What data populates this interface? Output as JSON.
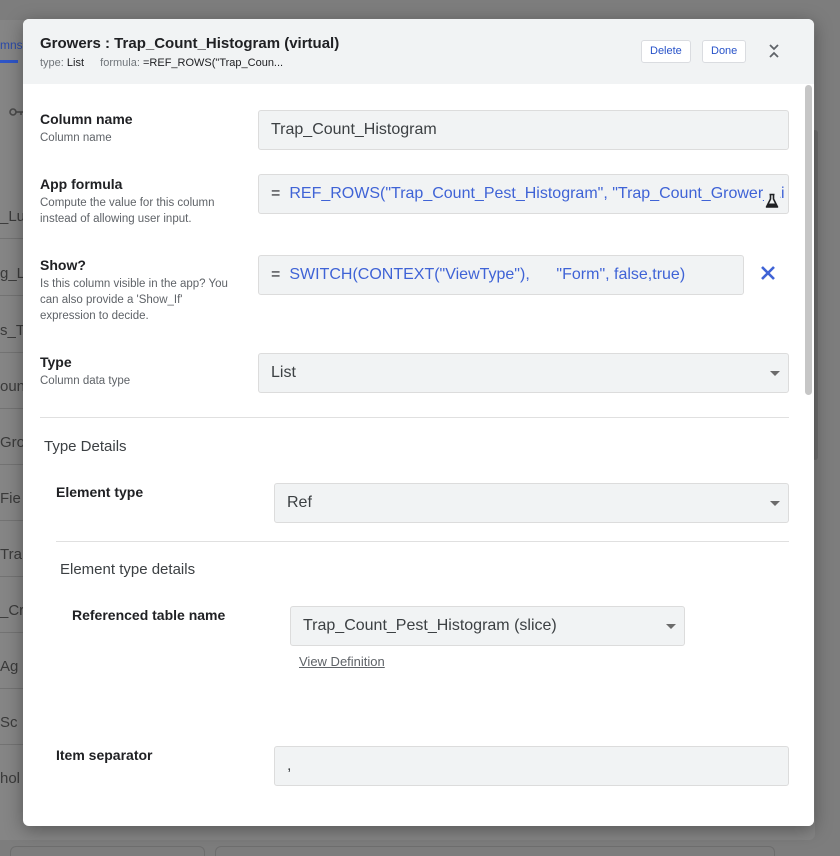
{
  "background": {
    "tab_label": "mns",
    "rows": [
      "_Lu",
      "g_L",
      "s_T",
      "oun",
      "Gro",
      "Fie",
      "Tra",
      "_Cr",
      "Ag",
      "Sc",
      "hol"
    ]
  },
  "header": {
    "title": "Growers : Trap_Count_Histogram (virtual)",
    "type_label": "type:",
    "type_value": "List",
    "formula_label": "formula:",
    "formula_value": "=REF_ROWS(\"Trap_Coun..."
  },
  "buttons": {
    "delete": "Delete",
    "done": "Done"
  },
  "fields": {
    "column_name": {
      "label": "Column name",
      "hint": "Column name",
      "value": "Trap_Count_Histogram"
    },
    "app_formula": {
      "label": "App formula",
      "hint": "Compute the value for this column instead of allowing user input.",
      "prefix": "=",
      "value": "REF_ROWS(\"Trap_Count_Pest_Histogram\", \"Trap_Count_Grower_Li"
    },
    "show": {
      "label": "Show?",
      "hint": "Is this column visible in the app? You can also provide a 'Show_If' expression to decide.",
      "prefix": "=",
      "value": "SWITCH(CONTEXT(\"ViewType\"),      \"Form\", false,true)"
    },
    "type": {
      "label": "Type",
      "hint": "Column data type",
      "value": "List"
    }
  },
  "type_details": {
    "heading": "Type Details",
    "element_type_label": "Element type",
    "element_type_value": "Ref",
    "element_details_heading": "Element type details",
    "ref_table_label": "Referenced table name",
    "ref_table_value": "Trap_Count_Pest_Histogram (slice)",
    "view_definition": "View Definition",
    "item_separator_label": "Item separator",
    "item_separator_value": ","
  },
  "icons": {
    "collapse": "collapse-icon",
    "flask": "flask-icon",
    "clear": "close-icon",
    "dropdown": "chevron-down-icon"
  },
  "colors": {
    "accent": "#2752c9",
    "formula_text": "#3f63d6",
    "header_bg": "#f1f3f4"
  }
}
